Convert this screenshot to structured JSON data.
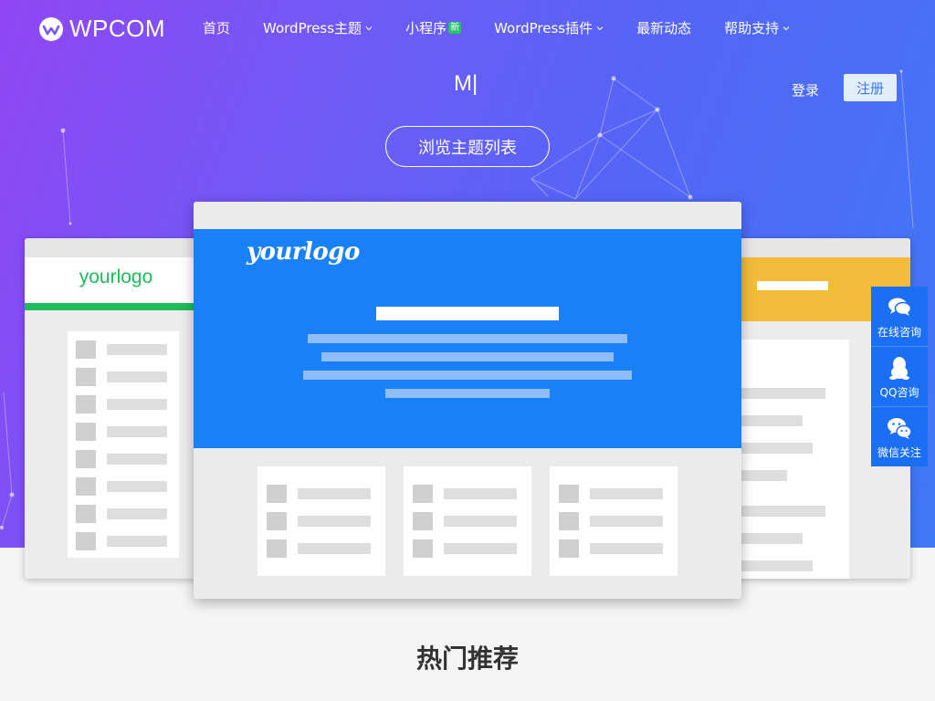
{
  "brand": {
    "name": "WPCOM"
  },
  "nav": {
    "items": [
      {
        "label": "首页",
        "has_dropdown": false
      },
      {
        "label": "WordPress主题",
        "has_dropdown": true
      },
      {
        "label": "小程序",
        "has_dropdown": false,
        "badge": "新"
      },
      {
        "label": "WordPress插件",
        "has_dropdown": true
      },
      {
        "label": "最新动态",
        "has_dropdown": false
      },
      {
        "label": "帮助支持",
        "has_dropdown": true
      }
    ]
  },
  "hero": {
    "typing_text": "M|",
    "browse_button": "浏览主题列表"
  },
  "auth": {
    "login": "登录",
    "register": "注册"
  },
  "mockups": {
    "left_logo": "yourlogo",
    "main_logo": "yourlogo"
  },
  "side_panel": {
    "items": [
      {
        "label": "在线咨询",
        "icon": "chat-bubbles-icon"
      },
      {
        "label": "QQ咨询",
        "icon": "qq-penguin-icon"
      },
      {
        "label": "微信关注",
        "icon": "wechat-icon"
      }
    ]
  },
  "sections": {
    "hot_title": "热门推荐"
  },
  "colors": {
    "hero_gradient_start": "#9046f4",
    "hero_gradient_end": "#3f78f5",
    "accent_blue": "#1a80f6",
    "side_panel": "#1a6ff5",
    "green": "#1fbb5c",
    "yellow": "#f2bb3a",
    "new_badge": "#27c26a"
  }
}
